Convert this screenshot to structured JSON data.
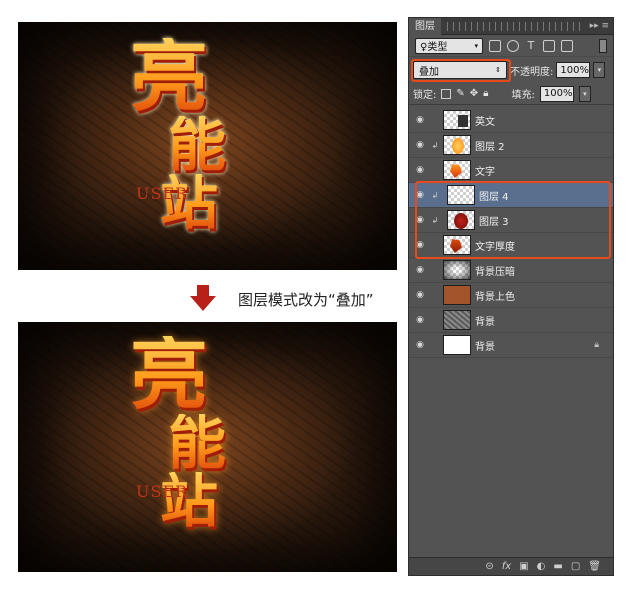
{
  "artwork": {
    "title_line1": "亮",
    "title_line2": "能",
    "title_line3": "站",
    "sub_text": "USER"
  },
  "instruction": "图层模式改为“叠加”",
  "panel": {
    "tab_label": "图层",
    "filter_kind": "♀类型",
    "filter_text_icon": "T",
    "blend_mode": "叠加",
    "opacity_label": "不透明度:",
    "opacity_value": "100%",
    "lock_label": "锁定:",
    "fill_label": "填充:",
    "fill_value": "100%",
    "layers": [
      {
        "name": "英文"
      },
      {
        "name": "图层 2"
      },
      {
        "name": "文字"
      },
      {
        "name": "图层 4"
      },
      {
        "name": "图层 3"
      },
      {
        "name": "文字厚度"
      },
      {
        "name": "背景压暗"
      },
      {
        "name": "背景上色"
      },
      {
        "name": "背景"
      },
      {
        "name": "背景"
      }
    ],
    "footer_icons": [
      "link-icon",
      "fx-icon",
      "mask-icon",
      "adjustment-icon",
      "group-icon",
      "new-layer-icon",
      "trash-icon"
    ]
  },
  "colors": {
    "highlight_frame": "#e84a1c",
    "panel_bg": "#535353",
    "selected_layer": "#5a6f8e",
    "arrow": "#b8201a",
    "swatch_brown": "#a4542a"
  }
}
